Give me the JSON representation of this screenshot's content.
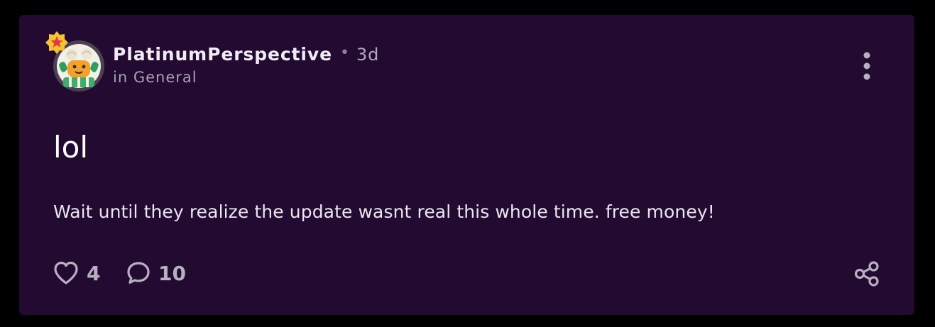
{
  "post": {
    "author": "PlatinumPerspective",
    "separator": "•",
    "time_ago": "3d",
    "community": "in General",
    "title": "lol",
    "body": "Wait until they realize the update wasnt real this whole time. free money!",
    "likes": "4",
    "comments": "10"
  },
  "icons": {
    "badge": "star-badge-icon",
    "menu": "more-vertical-icon",
    "like": "heart-outline-icon",
    "comment": "speech-bubble-icon",
    "share": "share-icon"
  },
  "colors": {
    "background": "#000000",
    "card": "#220a31",
    "badge": "#f4c430",
    "badge_star": "#e8304a",
    "text_primary": "#f1ecf4",
    "text_muted": "#aaa0b3",
    "icon": "#b8afc0"
  }
}
